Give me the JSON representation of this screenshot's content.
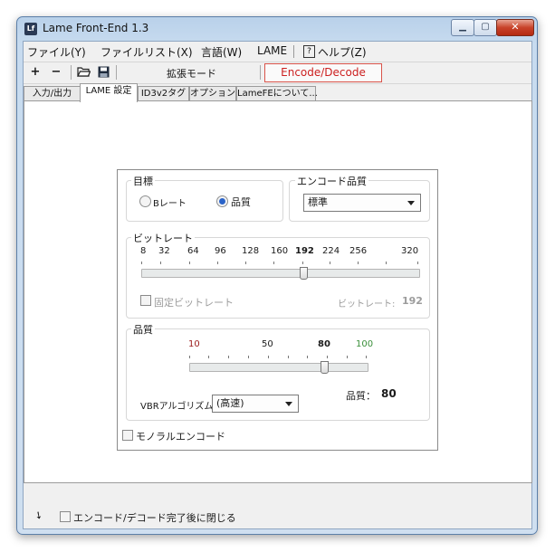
{
  "window": {
    "title": "Lame Front-End 1.3",
    "icon_text": "Lf"
  },
  "menu": [
    "ファイル(Y)",
    "ファイルリスト(X)",
    "言語(W)",
    "LAME",
    "ヘルプ(Z)"
  ],
  "toolbar": {
    "add": "+",
    "remove": "−",
    "mode_label": "拡張モード",
    "encode_decode": "Encode/Decode"
  },
  "tabs": [
    "入力/出力",
    "LAME 設定",
    "ID3v2タグ",
    "オプション",
    "LameFEについて..."
  ],
  "target": {
    "label": "目標",
    "bitrate_option": "Bレート",
    "quality_option": "品質",
    "selected": "品質"
  },
  "encode_quality": {
    "label": "エンコード品質",
    "value": "標準"
  },
  "bitrate": {
    "label": "ビットレート",
    "ticks": [
      "8",
      "32",
      "64",
      "96",
      "128",
      "160",
      "192",
      "224",
      "256",
      "320"
    ],
    "highlighted": "192",
    "fixed_label": "固定ビットレート",
    "readout_label": "ビットレート:",
    "readout_value": "192"
  },
  "quality": {
    "label": "品質",
    "ticks": [
      "10",
      "50",
      "80",
      "100"
    ],
    "vbr_label": "VBRアルゴリズム:",
    "vbr_value": "(高速)",
    "readout_label": "品質：",
    "readout_value": "80"
  },
  "mono_label": "モノラルエンコード",
  "close_after_label": "エンコード/デコード完了後に閉じる",
  "colors": {
    "accent": "#2b64c9",
    "encode_red": "#cc1f1f",
    "quality_low": "#9b1c1c",
    "quality_high": "#3a8f3a"
  }
}
